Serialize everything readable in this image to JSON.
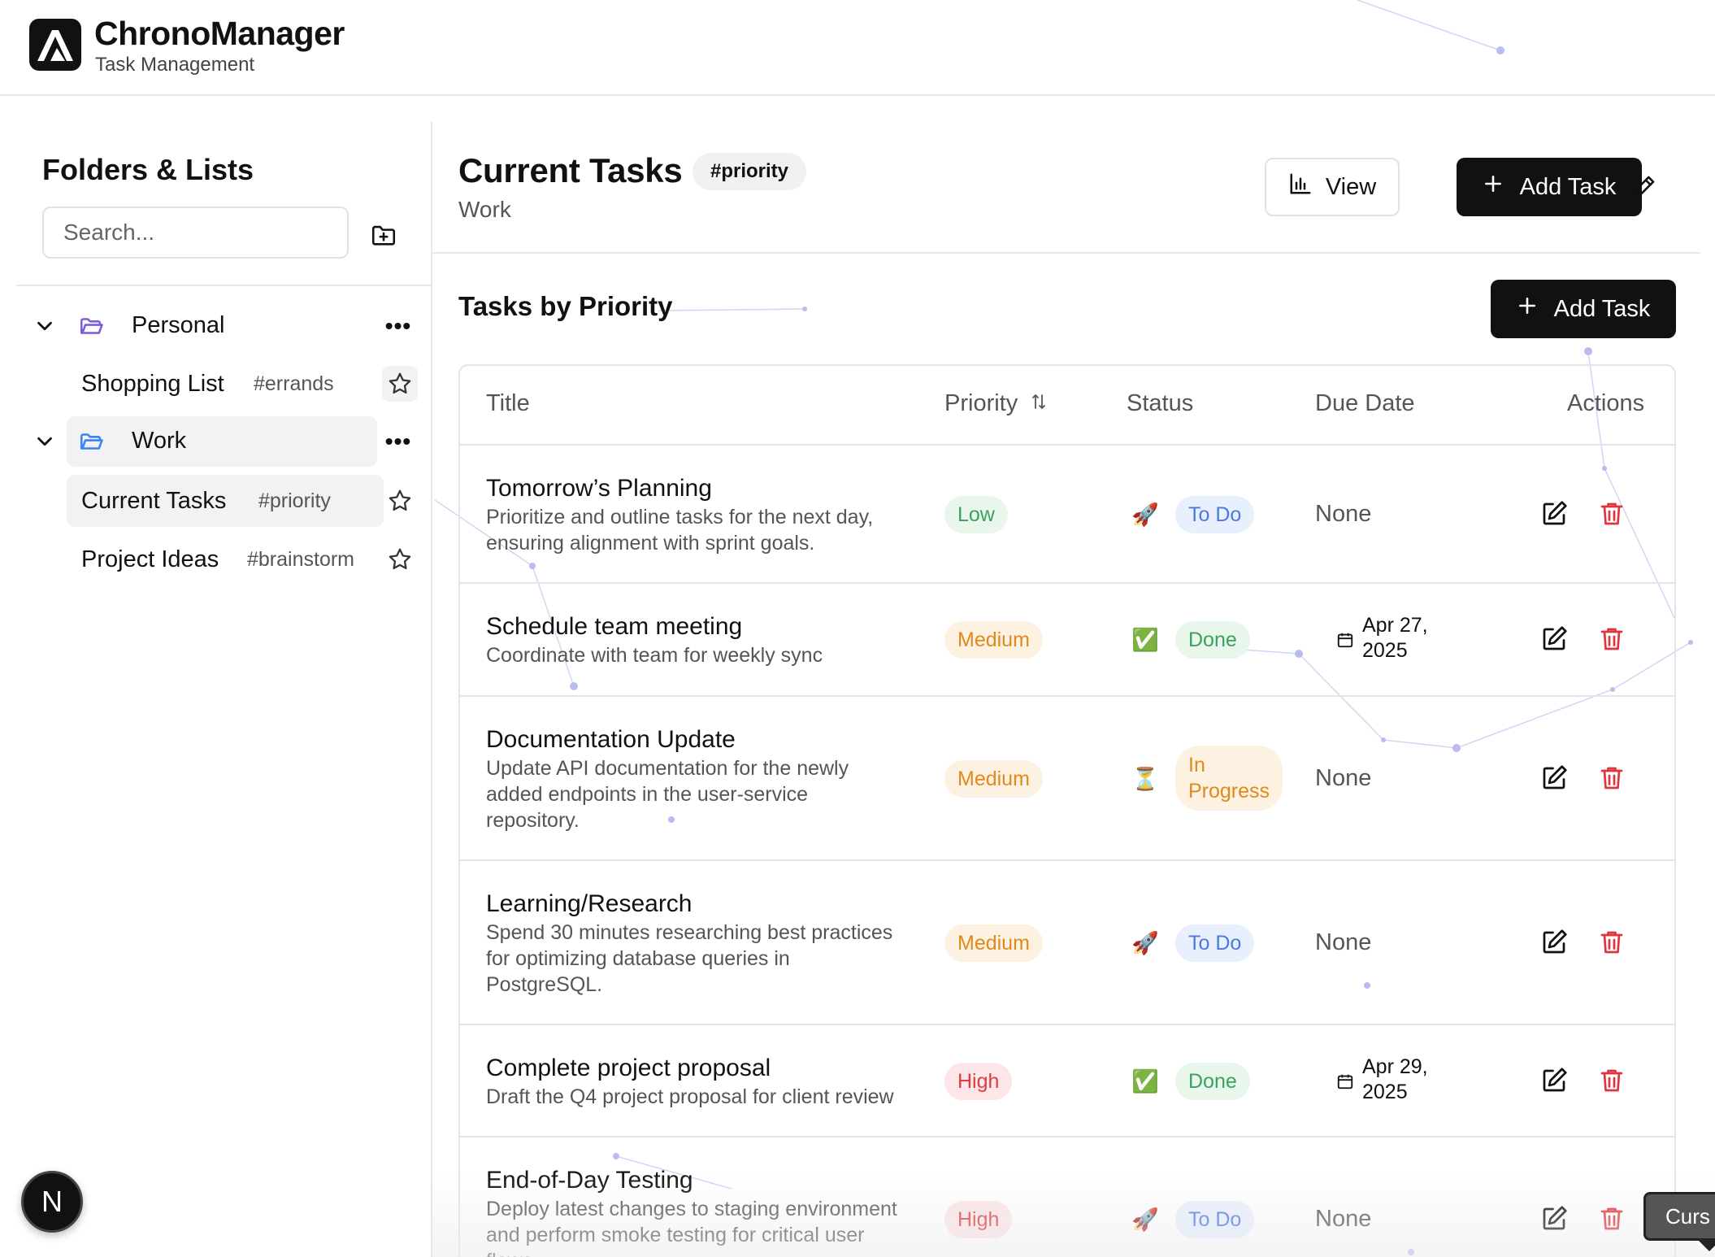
{
  "app": {
    "title": "ChronoManager",
    "subtitle": "Task Management"
  },
  "sidebar": {
    "title": "Folders & Lists",
    "search_placeholder": "Search...",
    "folders": [
      {
        "name": "Personal",
        "icon": "folder-open-icon",
        "color": "#7c5ce0",
        "lists": [
          {
            "name": "Shopping List",
            "tag": "#errands"
          }
        ]
      },
      {
        "name": "Work",
        "icon": "folder-open-icon",
        "color": "#3b82f6",
        "lists": [
          {
            "name": "Current Tasks",
            "tag": "#priority"
          },
          {
            "name": "Project Ideas",
            "tag": "#brainstorm"
          }
        ]
      }
    ],
    "badge_letter": "N"
  },
  "main": {
    "title": "Current Tasks",
    "tag": "#priority",
    "subtitle": "Work",
    "view_label": "View",
    "add_task_label": "Add Task",
    "section_title": "Tasks by Priority",
    "columns": {
      "title": "Title",
      "priority": "Priority",
      "status": "Status",
      "due": "Due Date",
      "actions": "Actions"
    },
    "tasks": [
      {
        "title": "Tomorrow’s Planning",
        "desc": [
          "Prioritize and outline tasks for the next day,",
          "ensuring alignment with sprint goals."
        ],
        "priority": "Low",
        "status_icon": "🚀",
        "status": "To Do",
        "due": "None"
      },
      {
        "title": "Schedule team meeting",
        "desc": [
          "Coordinate with team for weekly sync"
        ],
        "priority": "Medium",
        "status_icon": "✅",
        "status": "Done",
        "due": [
          "Apr 27,",
          "2025"
        ]
      },
      {
        "title": "Documentation Update",
        "desc": [
          "Update API documentation for the newly",
          "added endpoints in the user-service",
          "repository."
        ],
        "priority": "Medium",
        "status_icon": "⏳",
        "status": [
          "In",
          "Progress"
        ],
        "due": "None"
      },
      {
        "title": "Learning/Research",
        "desc": [
          "Spend 30 minutes researching best practices",
          "for optimizing database queries in",
          "PostgreSQL."
        ],
        "priority": "Medium",
        "status_icon": "🚀",
        "status": "To Do",
        "due": "None"
      },
      {
        "title": "Complete project proposal",
        "desc": [
          "Draft the Q4 project proposal for client review"
        ],
        "priority": "High",
        "status_icon": "✅",
        "status": "Done",
        "due": [
          "Apr 29,",
          "2025"
        ]
      },
      {
        "title": "End-of-Day Testing",
        "desc": [
          "Deploy latest changes to staging environment",
          "and perform smoke testing for critical user",
          "flows."
        ],
        "priority": "High",
        "status_icon": "🚀",
        "status": "To Do",
        "due": "None"
      }
    ],
    "cursor_tooltip": "Curs"
  },
  "colors": {
    "low_text": "#3aa25c",
    "medium_text": "#e08a1d",
    "high_text": "#dc3c42",
    "todo_text": "#4a79e0",
    "delete_icon": "#e0353c",
    "dark_button": "#111111"
  }
}
